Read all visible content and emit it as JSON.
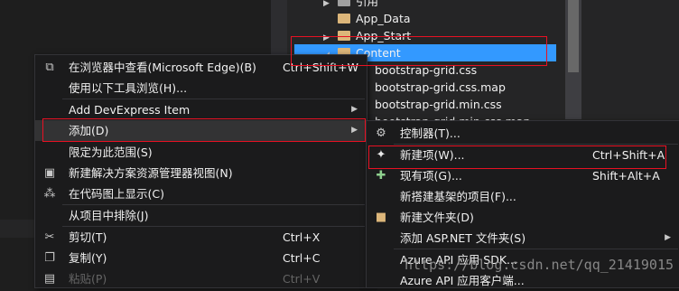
{
  "solution_explorer": {
    "tree": [
      {
        "label": "引用",
        "expander": "▶"
      },
      {
        "label": "App_Data",
        "expander": ""
      },
      {
        "label": "App_Start",
        "expander": "▶"
      },
      {
        "label": "Content",
        "expander": "◢"
      }
    ],
    "files": [
      "bootstrap-grid.css",
      "bootstrap-grid.css.map",
      "bootstrap-grid.min.css",
      "bootstrap-grid.min.css.map"
    ]
  },
  "context_menu": {
    "items": [
      {
        "label": "在浏览器中查看(Microsoft Edge)(B)",
        "shortcut": "Ctrl+Shift+W",
        "icon": "browser-icon"
      },
      {
        "label": "使用以下工具浏览(H)...",
        "shortcut": "",
        "icon": ""
      },
      {
        "label": "Add DevExpress Item",
        "shortcut": "",
        "icon": ""
      },
      {
        "label": "添加(D)",
        "shortcut": "",
        "icon": ""
      },
      {
        "label": "限定为此范围(S)",
        "shortcut": "",
        "icon": ""
      },
      {
        "label": "新建解决方案资源管理器视图(N)",
        "shortcut": "",
        "icon": "new-view-icon"
      },
      {
        "label": "在代码图上显示(C)",
        "shortcut": "",
        "icon": "code-map-icon"
      },
      {
        "label": "从项目中排除(J)",
        "shortcut": "",
        "icon": ""
      },
      {
        "label": "剪切(T)",
        "shortcut": "Ctrl+X",
        "icon": "scissors-icon"
      },
      {
        "label": "复制(Y)",
        "shortcut": "Ctrl+C",
        "icon": "copy-icon"
      },
      {
        "label": "粘贴(P)",
        "shortcut": "Ctrl+V",
        "icon": "paste-icon"
      }
    ]
  },
  "submenu": {
    "items": [
      {
        "label": "控制器(T)...",
        "shortcut": "",
        "icon": "controller-icon"
      },
      {
        "label": "新建项(W)...",
        "shortcut": "Ctrl+Shift+A",
        "icon": "new-item-icon"
      },
      {
        "label": "现有项(G)...",
        "shortcut": "Shift+Alt+A",
        "icon": "existing-item-icon"
      },
      {
        "label": "新搭建基架的项目(F)...",
        "shortcut": "",
        "icon": ""
      },
      {
        "label": "新建文件夹(D)",
        "shortcut": "",
        "icon": "new-folder-icon"
      },
      {
        "label": "添加 ASP.NET 文件夹(S)",
        "shortcut": "",
        "icon": ""
      },
      {
        "label": "Azure API 应用 SDK...",
        "shortcut": "",
        "icon": ""
      },
      {
        "label": "Azure API 应用客户端...",
        "shortcut": "",
        "icon": ""
      }
    ]
  },
  "watermark": "https://blog.csdn.net/qq_21419015",
  "colors": {
    "highlight": "#e81123",
    "selection": "#3399ff",
    "folder": "#dcb67a"
  }
}
